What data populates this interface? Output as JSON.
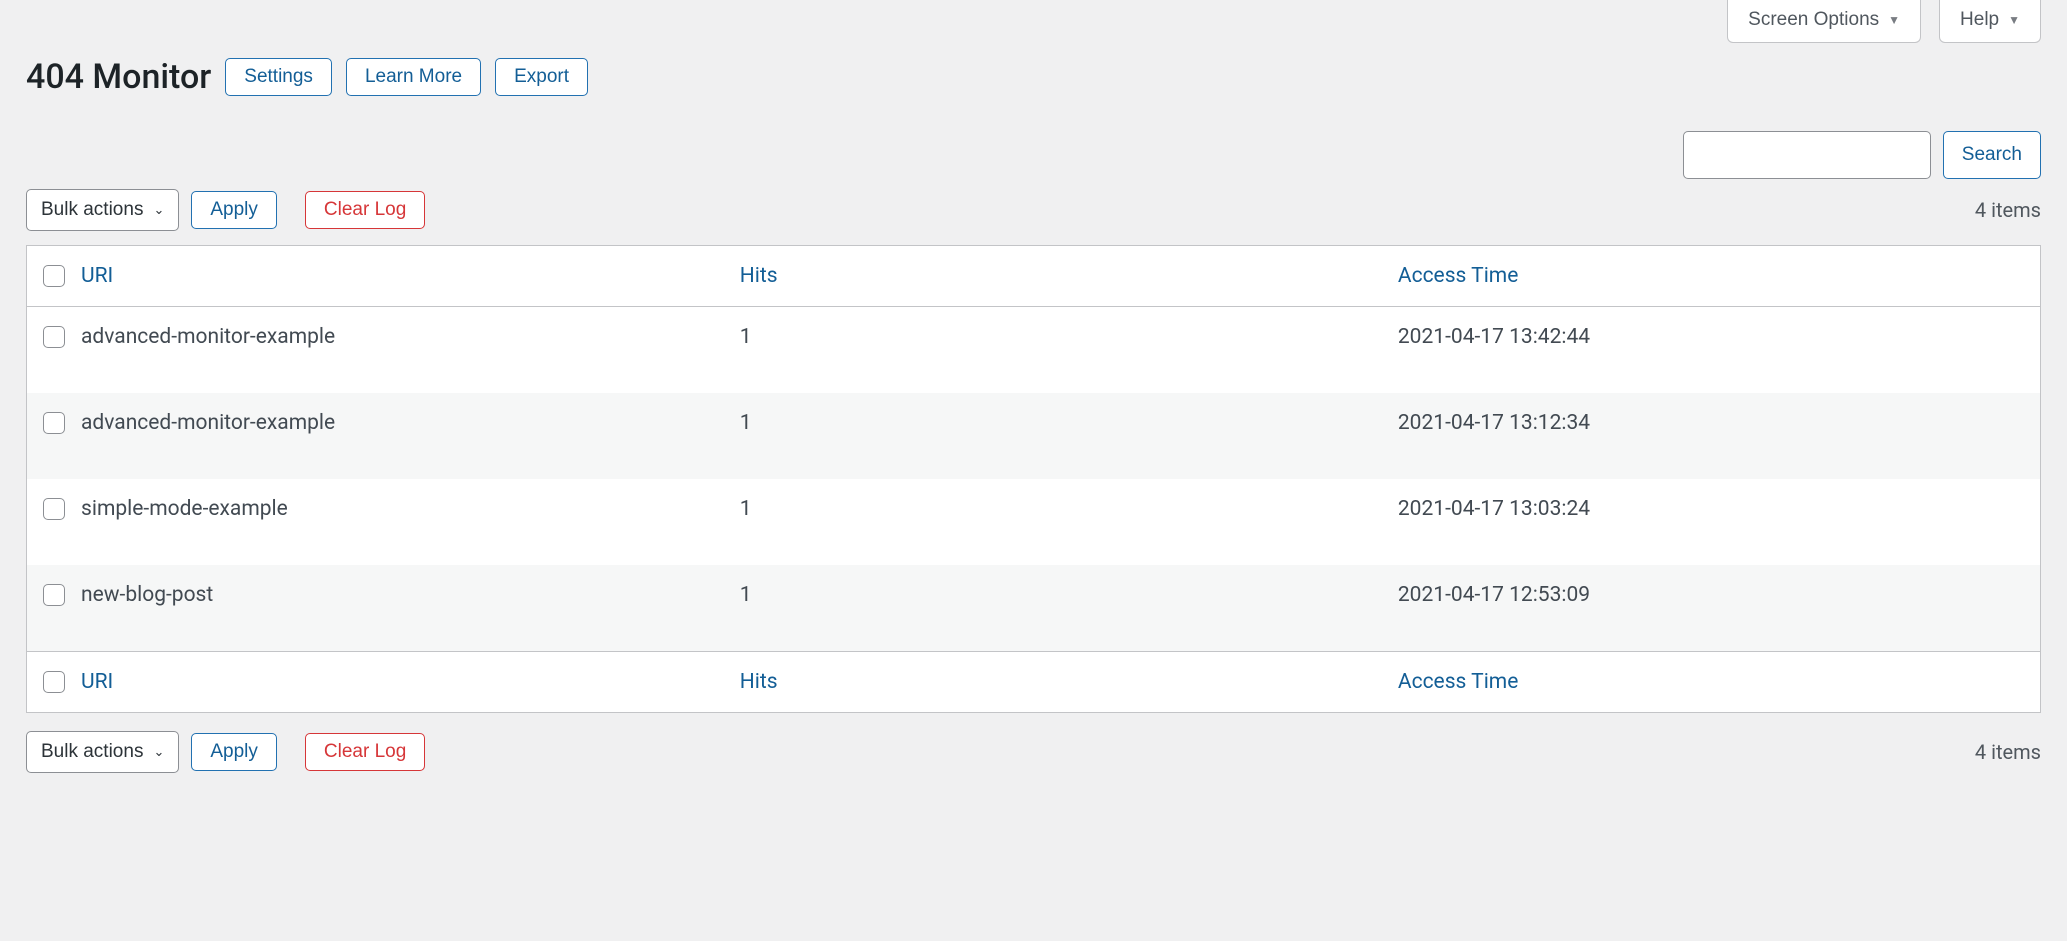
{
  "screenMeta": {
    "screenOptions": "Screen Options",
    "help": "Help"
  },
  "header": {
    "title": "404 Monitor",
    "settings": "Settings",
    "learnMore": "Learn More",
    "export": "Export"
  },
  "search": {
    "value": "",
    "button": "Search"
  },
  "bulk": {
    "label": "Bulk actions",
    "apply": "Apply",
    "clearLog": "Clear Log"
  },
  "pagination": {
    "count": "4 items"
  },
  "columns": {
    "uri": "URI",
    "hits": "Hits",
    "time": "Access Time"
  },
  "rows": [
    {
      "uri": "advanced-monitor-example",
      "hits": "1",
      "time": "2021-04-17 13:42:44"
    },
    {
      "uri": "advanced-monitor-example",
      "hits": "1",
      "time": "2021-04-17 13:12:34"
    },
    {
      "uri": "simple-mode-example",
      "hits": "1",
      "time": "2021-04-17 13:03:24"
    },
    {
      "uri": "new-blog-post",
      "hits": "1",
      "time": "2021-04-17 12:53:09"
    }
  ]
}
